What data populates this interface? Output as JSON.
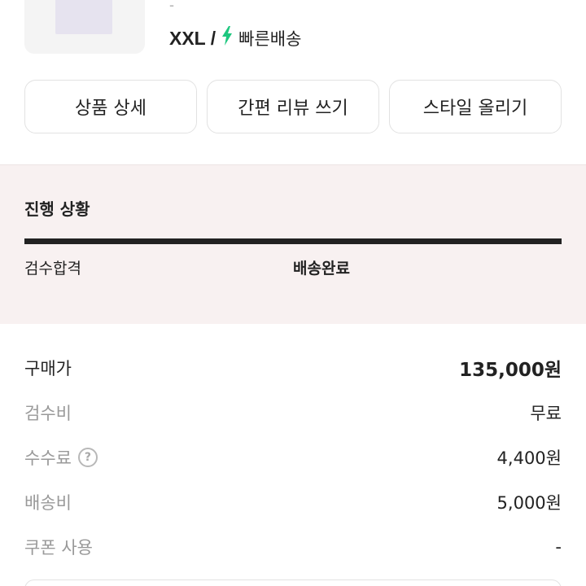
{
  "product": {
    "dash": "-",
    "size": "XXL",
    "separator": "/",
    "shipping_label": "빠른배송",
    "shipping_icon": "lightning-bolt-icon",
    "accent_color": "#1ec77f"
  },
  "actions": {
    "detail": "상품 상세",
    "review": "간편 리뷰 쓰기",
    "style": "스타일 올리기"
  },
  "progress": {
    "title": "진행 상황",
    "steps": [
      {
        "label": "검수합격"
      },
      {
        "label": "배송완료"
      }
    ]
  },
  "prices": [
    {
      "label": "구매가",
      "value": "135,000원"
    },
    {
      "label": "검수비",
      "value": "무료"
    },
    {
      "label": "수수료",
      "value": "4,400원",
      "help_icon": "?"
    },
    {
      "label": "배송비",
      "value": "5,000원"
    },
    {
      "label": "쿠폰 사용",
      "value": "-"
    }
  ]
}
